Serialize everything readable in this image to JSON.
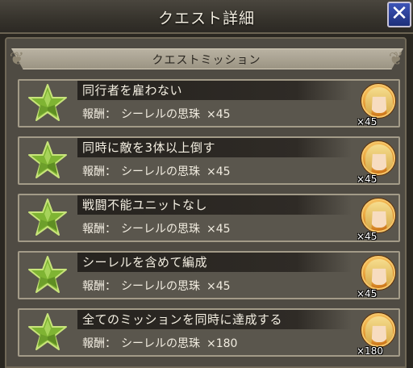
{
  "header": {
    "title": "クエスト詳細",
    "close_label": "✕"
  },
  "section": {
    "title": "クエストミッション"
  },
  "missions": [
    {
      "name": "同行者を雇わない",
      "reward_label": "報酬：",
      "reward_item": "シーレルの思珠",
      "reward_count": "×45",
      "thumb_count": "×45"
    },
    {
      "name": "同時に敵を3体以上倒す",
      "reward_label": "報酬：",
      "reward_item": "シーレルの思珠",
      "reward_count": "×45",
      "thumb_count": "×45"
    },
    {
      "name": "戦闘不能ユニットなし",
      "reward_label": "報酬：",
      "reward_item": "シーレルの思珠",
      "reward_count": "×45",
      "thumb_count": "×45"
    },
    {
      "name": "シーレルを含めて編成",
      "reward_label": "報酬：",
      "reward_item": "シーレルの思珠",
      "reward_count": "×45",
      "thumb_count": "×45"
    },
    {
      "name": "全てのミッションを同時に達成する",
      "reward_label": "報酬：",
      "reward_item": "シーレルの思珠",
      "reward_count": "×180",
      "thumb_count": "×180"
    }
  ],
  "colors": {
    "star": "#8cbf3a",
    "close_button": "#2a44a8",
    "medal": "#e89a2e"
  },
  "icons": {
    "close": "close-icon",
    "star": "star-icon",
    "reward": "character-medal-icon"
  }
}
